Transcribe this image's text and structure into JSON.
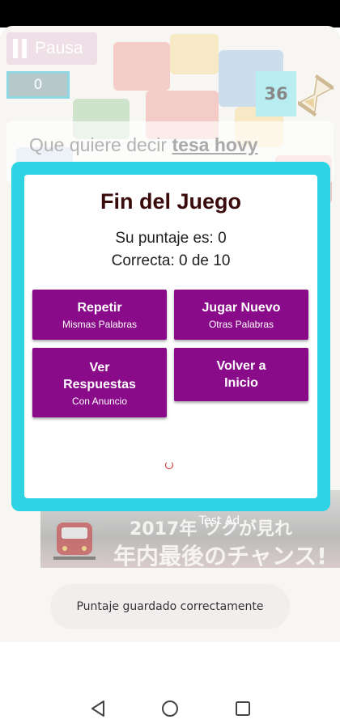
{
  "header": {
    "pause_label": "Pausa",
    "score": "0",
    "timer": "36"
  },
  "question": {
    "prefix": "Que quiere decir ",
    "word": "tesa hovy"
  },
  "dialog": {
    "title": "Fin del Juego",
    "score_line": "Su puntaje es: 0",
    "correct_line": "Correcta: 0  de  10",
    "buttons": {
      "repeat": {
        "label": "Repetir",
        "sub": "Mismas Palabras"
      },
      "new_game": {
        "label": "Jugar Nuevo",
        "sub": "Otras Palabras"
      },
      "answers": {
        "label_line1": "Ver",
        "label_line2": "Respuestas",
        "sub": "Con Anuncio"
      },
      "home": {
        "label_line1": "Volver a",
        "label_line2": "Inicio"
      }
    }
  },
  "ad": {
    "label": "Test Ad",
    "line1": "2017年 ツクが見れ",
    "line2": "年内最後のチャンス!"
  },
  "toast": "Puntaje guardado correctamente",
  "colors": {
    "dialog_frame": "#2ed4e3",
    "button": "#8a0b8a",
    "title": "#3a0b0b"
  },
  "icons": [
    "pause-icon",
    "hourglass-icon",
    "back-icon",
    "home-icon",
    "recents-icon"
  ]
}
